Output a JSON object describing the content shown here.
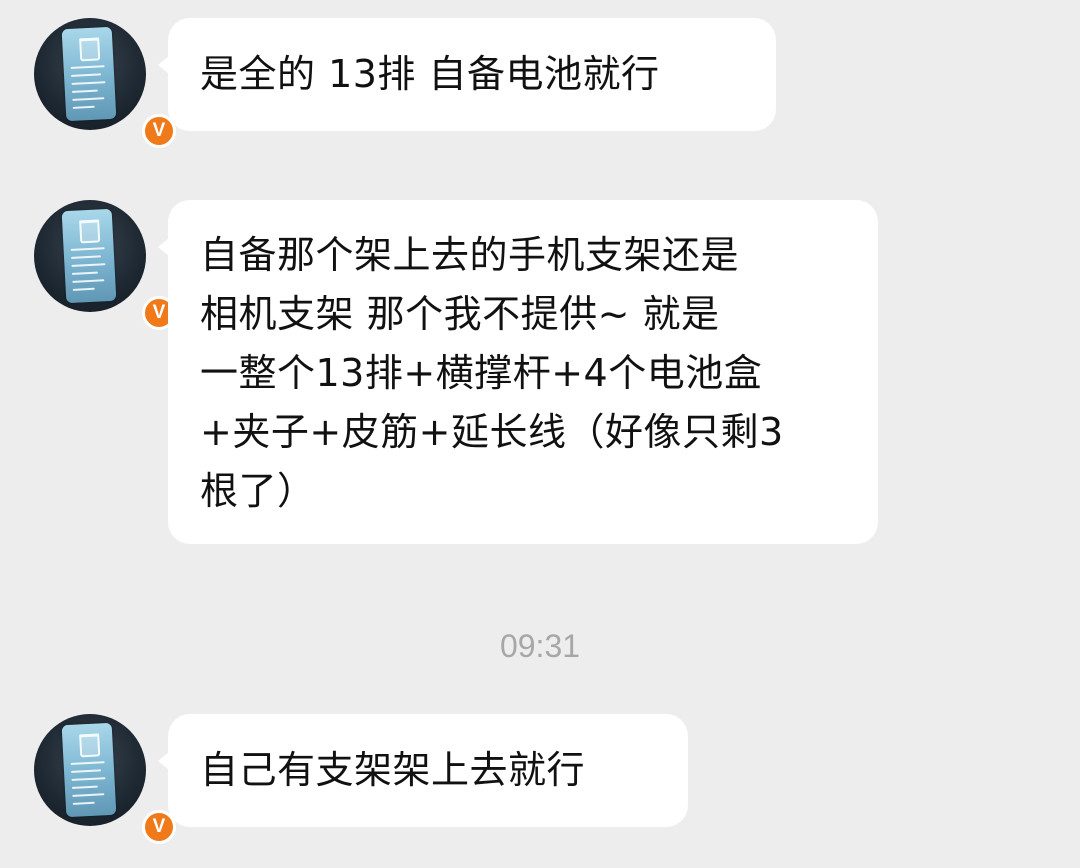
{
  "messages": [
    {
      "sender": "other",
      "badge": "V",
      "text": "是全的 13排  自备电池就行"
    },
    {
      "sender": "other",
      "badge": "V",
      "text": "自备那个架上去的手机支架还是\n相机支架 那个我不提供~ 就是\n一整个13排+横撑杆+4个电池盒\n+夹子+皮筋+延长线（好像只剩3\n根了）"
    },
    {
      "sender": "other",
      "badge": "V",
      "text": "自己有支架架上去就行"
    }
  ],
  "timestamp": "09:31"
}
